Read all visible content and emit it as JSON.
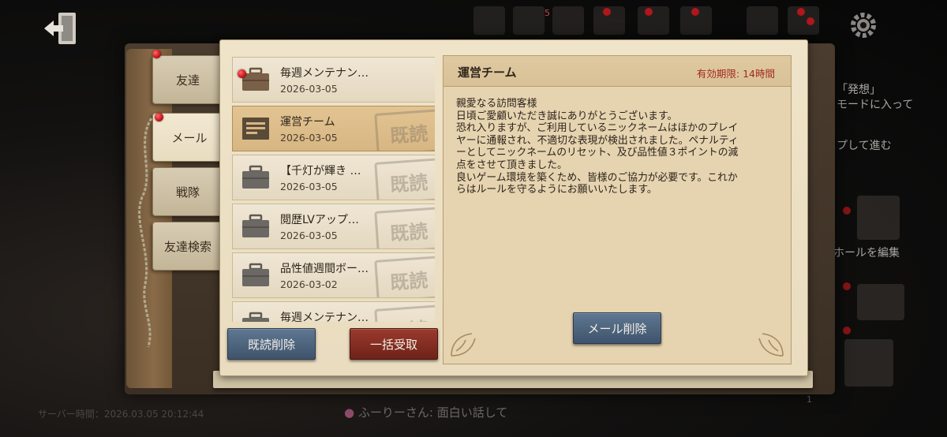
{
  "tabs": [
    {
      "label": "友達",
      "has_dot": true
    },
    {
      "label": "メール",
      "has_dot": true
    },
    {
      "label": "戦隊",
      "has_dot": false
    },
    {
      "label": "友達検索",
      "has_dot": false
    }
  ],
  "top_badge": "5",
  "mails": [
    {
      "title": "毎週メンテナン…",
      "date": "2026-03-05",
      "unread": true,
      "read_stamp": false,
      "selected": false,
      "icon": "briefcase-icon"
    },
    {
      "title": "運営チーム",
      "date": "2026-03-05",
      "unread": false,
      "read_stamp": true,
      "selected": true,
      "icon": "document-icon"
    },
    {
      "title": "【千灯が輝き …",
      "date": "2026-03-05",
      "unread": false,
      "read_stamp": true,
      "selected": false,
      "icon": "briefcase-icon"
    },
    {
      "title": "閲歴LVアップ…",
      "date": "2026-03-05",
      "unread": false,
      "read_stamp": true,
      "selected": false,
      "icon": "briefcase-icon"
    },
    {
      "title": "品性値週間ボー…",
      "date": "2026-03-02",
      "unread": false,
      "read_stamp": true,
      "selected": false,
      "icon": "briefcase-icon"
    },
    {
      "title": "毎週メンテナン…",
      "date": "",
      "unread": false,
      "read_stamp": true,
      "selected": false,
      "icon": "briefcase-icon"
    }
  ],
  "stamp_text": "既読",
  "buttons": {
    "delete_read": "既読削除",
    "claim_all": "一括受取",
    "delete_mail": "メール削除"
  },
  "message": {
    "sender": "運営チーム",
    "expiry": "有効期限: 14時間",
    "lines": [
      "親愛なる訪問客様",
      "日頃ご愛顧いただき誠にありがとうございます。",
      "恐れ入りますが、ご利用しているニックネームはほかのプレイ",
      "ヤーに通報され、不適切な表現が検出されました。ペナルティ",
      "ーとしてニックネームのリセット、及び品性値３ポイントの減",
      "点をさせて頂きました。",
      "良いゲーム環境を築くため、皆様のご協力が必要です。これか",
      "らはルールを守るようにお願いいたします。"
    ]
  },
  "background": {
    "right_texts": [
      "「発想」",
      "モードに入って",
      "プして進む",
      "ホールを編集"
    ],
    "server_time": "サーバー時間：2026.03.05 20:12:44",
    "chat_line": "ふーりーさん: 面白い話して",
    "corner_badge": "1"
  },
  "colors": {
    "accent_red": "#c4141a",
    "button_blue": "#4f647c",
    "button_red": "#7d2a1f",
    "expiry_text": "#a32a1e",
    "paper": "#ece0c5"
  }
}
